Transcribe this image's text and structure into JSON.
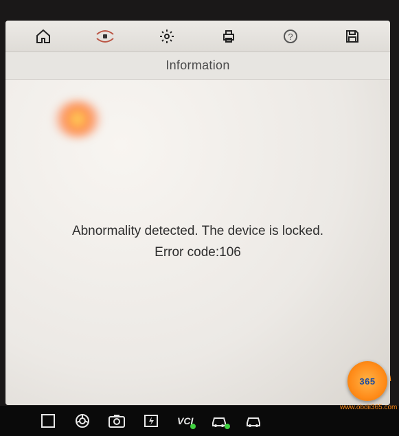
{
  "titleBar": "Information",
  "message": {
    "line1": "Abnormality detected. The device is locked.",
    "line2": "Error code:106"
  },
  "toolbar": {
    "home": "home-icon",
    "connection": "connection-icon",
    "settings": "gear-icon",
    "print": "printer-icon",
    "help": "help-icon",
    "save": "save-icon"
  },
  "bottomBar": {
    "apps": "apps-icon",
    "browser": "chrome-icon",
    "camera": "camera-icon",
    "flash": "flash-icon",
    "vci": "VCI",
    "vehicle1": "car-icon",
    "vehicle2": "car-icon"
  },
  "watermark": {
    "logoText": "365",
    "url": "www.obdii365.com"
  }
}
